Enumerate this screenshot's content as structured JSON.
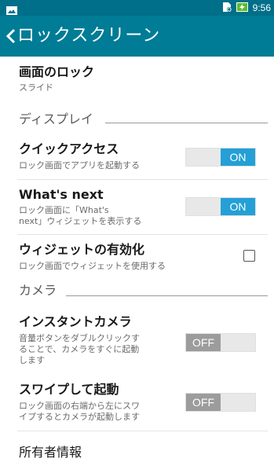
{
  "status_bar": {
    "time": "9:56",
    "left_icon": "image-icon",
    "right_icons": [
      "nfc-icon",
      "battery-charging-icon"
    ]
  },
  "app_bar": {
    "back_icon": "chevron-left-icon",
    "title": "ロックスクリーン"
  },
  "screen_lock": {
    "title": "画面のロック",
    "value": "スライド"
  },
  "sections": {
    "display": "ディスプレイ",
    "camera": "カメラ"
  },
  "quick_access": {
    "title": "クイックアクセス",
    "subtitle": "ロック画面でアプリを起動する",
    "toggle_label": "ON",
    "state": true
  },
  "whats_next": {
    "title": "What's next",
    "subtitle_line1": "ロック画面に「What's",
    "subtitle_line2": "next」ウィジェットを表示する",
    "toggle_label": "ON",
    "state": true
  },
  "widgets": {
    "title": "ウィジェットの有効化",
    "subtitle": "ロック画面でウィジェットを使用する",
    "checked": false
  },
  "instant_camera": {
    "title": "インスタントカメラ",
    "subtitle_line1": "音量ボタンをダブルクリックす",
    "subtitle_line2": "ることで、カメラをすぐに起動",
    "subtitle_line3": "します",
    "toggle_label": "OFF",
    "state": false
  },
  "swipe_launch": {
    "title": "スワイプして起動",
    "subtitle_line1": "ロック画面の右端から左にスワ",
    "subtitle_line2": "イプするとカメラが起動します",
    "toggle_label": "OFF",
    "state": false
  },
  "owner_info": {
    "title": "所有者情報"
  },
  "colors": {
    "status_bar": "#006f8a",
    "app_bar": "#007c96",
    "toggle_on": "#24a0d6",
    "toggle_off": "#9c9c9c"
  }
}
